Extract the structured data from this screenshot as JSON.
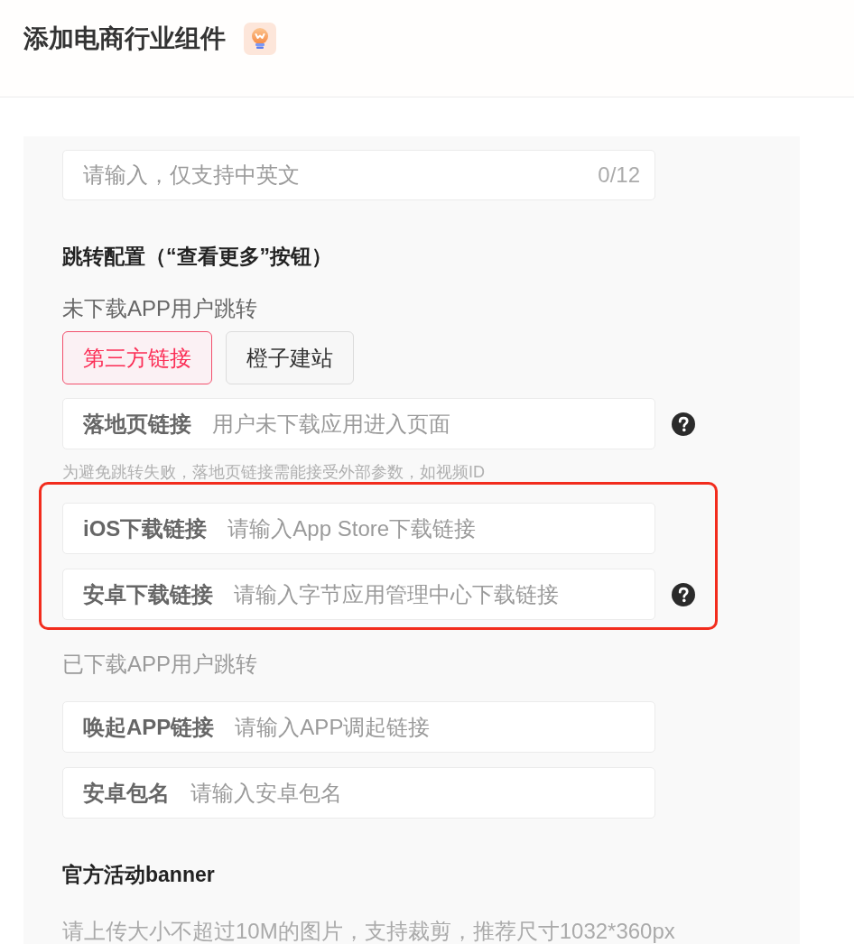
{
  "header": {
    "title": "添加电商行业组件"
  },
  "name_field": {
    "placeholder": "请输入，仅支持中英文",
    "counter": "0/12"
  },
  "jump_config": {
    "title": "跳转配置（“查看更多”按钮）",
    "not_installed": {
      "label": "未下载APP用户跳转",
      "options": [
        {
          "label": "第三方链接",
          "selected": true
        },
        {
          "label": "橙子建站",
          "selected": false
        }
      ],
      "fields": [
        {
          "label": "落地页链接",
          "placeholder": "用户未下载应用进入页面",
          "help": true
        }
      ],
      "note": "为避免跳转失败，落地页链接需能接受外部参数，如视频ID",
      "highlighted_fields": [
        {
          "label": "iOS下载链接",
          "placeholder": "请输入App Store下载链接",
          "help": false
        },
        {
          "label": "安卓下载链接",
          "placeholder": "请输入字节应用管理中心下载链接",
          "help": true
        }
      ]
    },
    "installed": {
      "label": "已下载APP用户跳转",
      "fields": [
        {
          "label": "唤起APP链接",
          "placeholder": "请输入APP调起链接",
          "help": false
        },
        {
          "label": "安卓包名",
          "placeholder": "请输入安卓包名",
          "help": false
        }
      ]
    }
  },
  "banner": {
    "title": "官方活动banner",
    "note": "请上传大小不超过10M的图片，支持裁剪，推荐尺寸1032*360px"
  }
}
